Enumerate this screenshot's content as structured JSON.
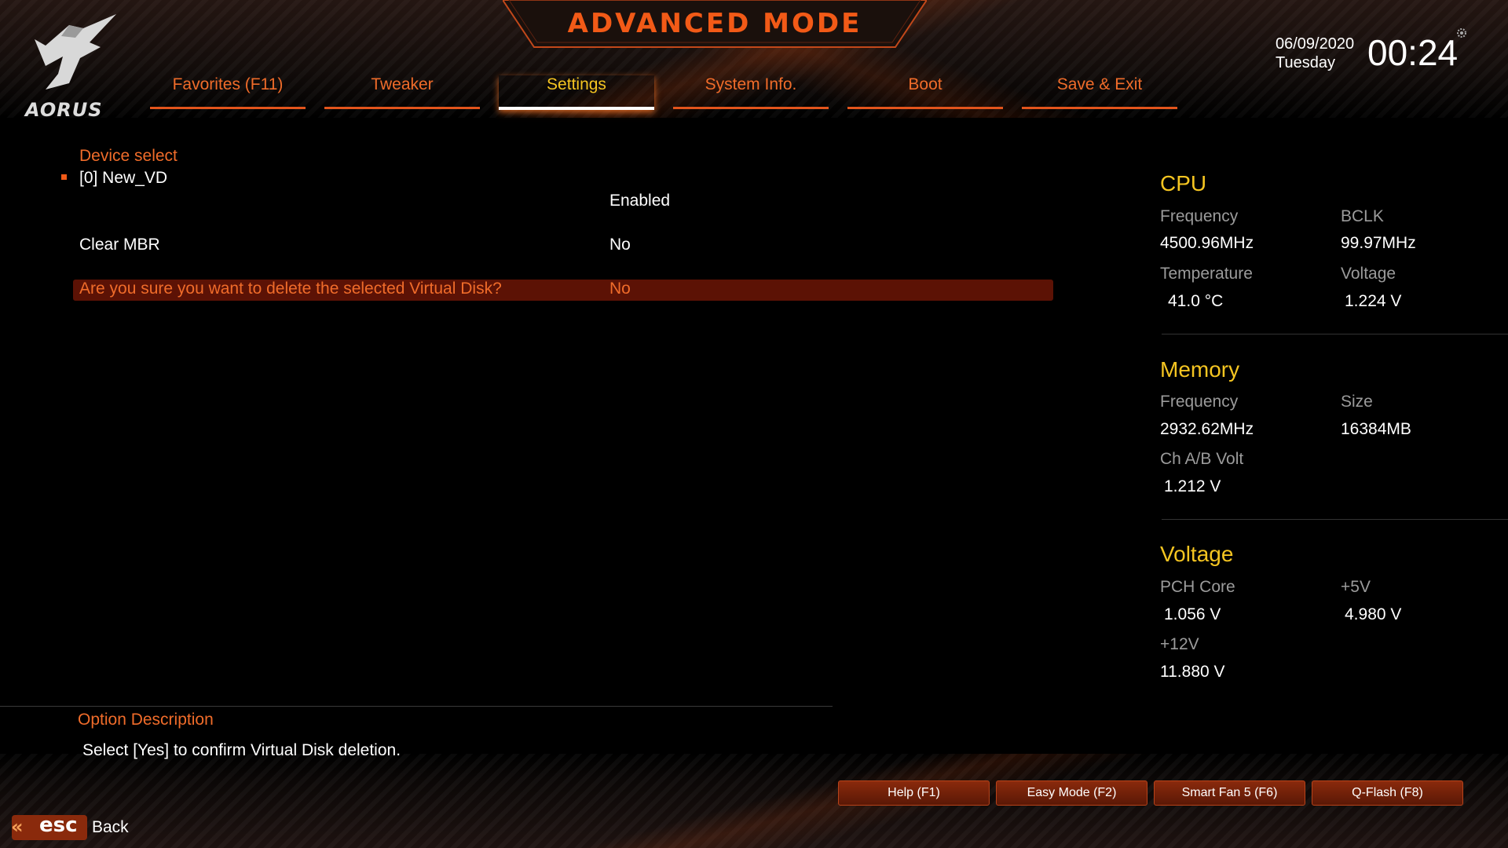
{
  "header": {
    "title": "ADVANCED MODE",
    "logo_text": "AORUS",
    "date": "06/09/2020",
    "day": "Tuesday",
    "time": "00:24"
  },
  "tabs": [
    {
      "label": "Favorites (F11)",
      "active": false
    },
    {
      "label": "Tweaker",
      "active": false
    },
    {
      "label": "Settings",
      "active": true
    },
    {
      "label": "System Info.",
      "active": false
    },
    {
      "label": "Boot",
      "active": false
    },
    {
      "label": "Save & Exit",
      "active": false
    }
  ],
  "settings": {
    "device_select_label": "Device select",
    "device_item": "[0] New_VD",
    "device_value": "Enabled",
    "clear_mbr_label": "Clear MBR",
    "clear_mbr_value": "No",
    "delete_confirm_label": "Are you sure you want to delete the selected Virtual Disk?",
    "delete_confirm_value": "No"
  },
  "cpu": {
    "title": "CPU",
    "frequency_label": "Frequency",
    "frequency_value": "4500.96MHz",
    "bclk_label": "BCLK",
    "bclk_value": "99.97MHz",
    "temperature_label": "Temperature",
    "temperature_value": "41.0 °C",
    "voltage_label": "Voltage",
    "voltage_value": "1.224 V"
  },
  "memory": {
    "title": "Memory",
    "frequency_label": "Frequency",
    "frequency_value": "2932.62MHz",
    "size_label": "Size",
    "size_value": "16384MB",
    "chab_label": "Ch A/B Volt",
    "chab_value": "1.212 V"
  },
  "voltage": {
    "title": "Voltage",
    "pch_label": "PCH Core",
    "pch_value": "1.056 V",
    "p5v_label": "+5V",
    "p5v_value": "4.980 V",
    "p12v_label": "+12V",
    "p12v_value": "11.880 V"
  },
  "option_description": {
    "title": "Option Description",
    "text": "Select [Yes] to confirm Virtual Disk deletion."
  },
  "footer": {
    "buttons": [
      "Help (F1)",
      "Easy Mode (F2)",
      "Smart Fan 5 (F6)",
      "Q-Flash (F8)"
    ],
    "esc_label": "esc",
    "back_label": "Back"
  },
  "colors": {
    "accent_orange": "#f06c2a",
    "accent_yellow": "#f5c521",
    "highlight_row": "#5c1205"
  }
}
